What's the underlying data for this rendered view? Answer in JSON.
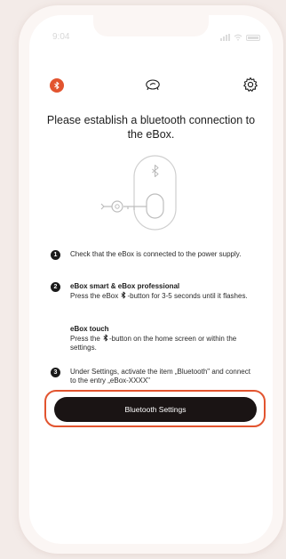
{
  "status_bar": {
    "time": "9:04"
  },
  "header": {
    "bluetooth_badge_icon": "bluetooth-icon",
    "logo_icon": "ebox-logo-icon",
    "settings_icon": "gear-icon"
  },
  "main": {
    "title": "Please establish a bluetooth connection to the eBox.",
    "steps": [
      {
        "number": "1",
        "text": "Check that the eBox is connected to the power supply."
      },
      {
        "number": "2",
        "heading": "eBox smart & eBox professional",
        "text_before": "Press the eBox ",
        "text_after": "-button for 3-5 seconds until it flashes."
      },
      {
        "heading": "eBox touch",
        "text_before": "Press the ",
        "text_after": "-button on the home screen or within the settings."
      },
      {
        "number": "3",
        "text": "Under Settings, activate the item „Bluetooth\" and connect to the entry „eBox-XXXX\""
      }
    ],
    "button_label": "Bluetooth Settings"
  },
  "colors": {
    "accent": "#e2542f",
    "button": "#1a1414",
    "background": "#f3ebe8"
  }
}
